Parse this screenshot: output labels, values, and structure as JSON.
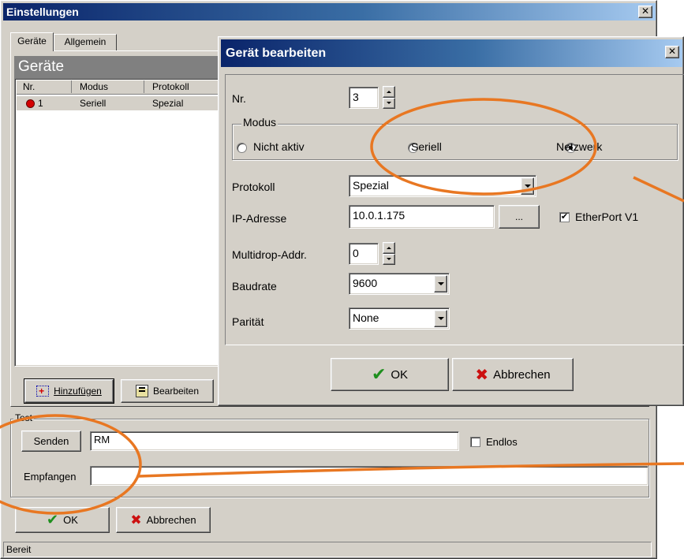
{
  "main_window": {
    "title": "Einstellungen",
    "close": "✕",
    "tabs": [
      {
        "label": "Geräte"
      },
      {
        "label": "Allgemein"
      }
    ],
    "panel_title": "Geräte",
    "columns": [
      "Nr.",
      "Modus",
      "Protokoll"
    ],
    "rows": [
      {
        "nr": "1",
        "modus": "Seriell",
        "protokoll": "Spezial"
      }
    ],
    "add_button": "Hinzufügen",
    "edit_button": "Bearbeiten",
    "test": {
      "group_label": "Test",
      "send_button": "Senden",
      "send_value": "RM",
      "endless_label": "Endlos",
      "endless_checked": false,
      "receive_label": "Empfangen",
      "receive_value": ""
    },
    "ok_button": "OK",
    "cancel_button": "Abbrechen",
    "status": "Bereit"
  },
  "dialog": {
    "title": "Gerät bearbeiten",
    "close": "✕",
    "nr_label": "Nr.",
    "nr_value": "3",
    "mode_group": "Modus",
    "modes": [
      {
        "label": "Nicht aktiv",
        "checked": false
      },
      {
        "label": "Seriell",
        "checked": false
      },
      {
        "label": "Netzwerk",
        "checked": true
      }
    ],
    "protocol_label": "Protokoll",
    "protocol_value": "Spezial",
    "ip_label": "IP-Adresse",
    "ip_value": "10.0.1.175",
    "browse_button": "...",
    "etherport_label": "EtherPort V1",
    "etherport_checked": true,
    "multidrop_label": "Multidrop-Addr.",
    "multidrop_value": "0",
    "baud_label": "Baudrate",
    "baud_value": "9600",
    "parity_label": "Parität",
    "parity_value": "None",
    "ok_button": "OK",
    "cancel_button": "Abbrechen"
  },
  "colors": {
    "title_gradient_start": "#0a246a",
    "title_gradient_end": "#a6caf0",
    "annotation": "#e87722",
    "error_dot": "#d40000",
    "ok_check": "#1e8f1e",
    "cancel_x": "#cc1010"
  },
  "icons": {
    "close": "close-icon",
    "device_status": "red-dot-icon",
    "add": "add-device-icon",
    "edit": "edit-device-icon",
    "ok": "checkmark-icon",
    "cancel": "cross-icon"
  }
}
